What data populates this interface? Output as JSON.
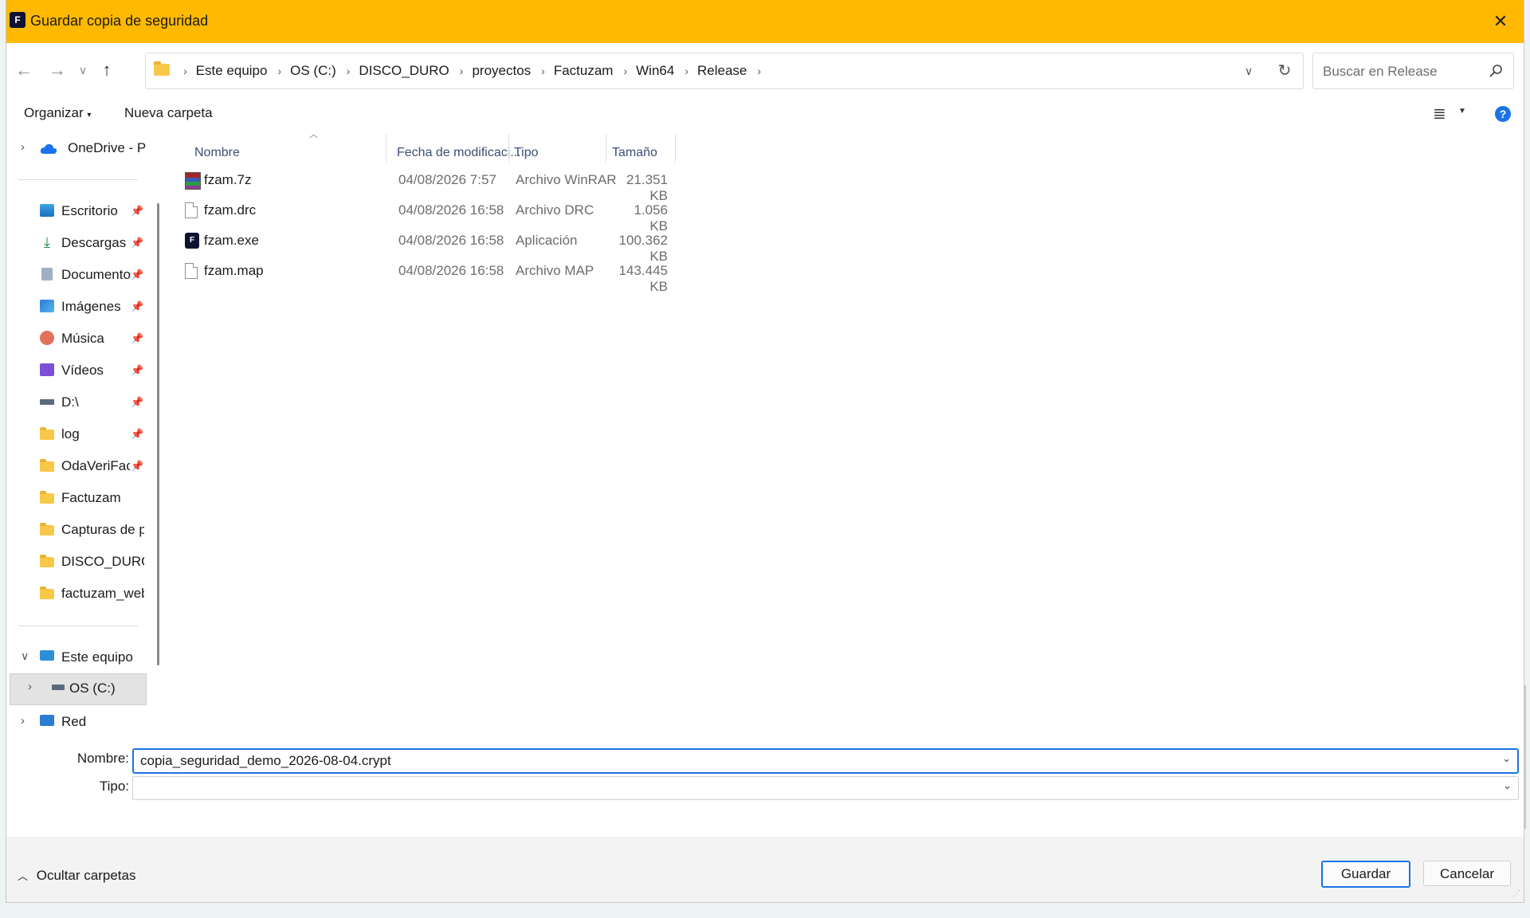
{
  "window": {
    "title": "Guardar copia de seguridad",
    "accent": "#ffb900"
  },
  "address": {
    "crumbs": [
      "Este equipo",
      "OS (C:)",
      "DISCO_DURO",
      "proyectos",
      "Factuzam",
      "Win64",
      "Release"
    ]
  },
  "search": {
    "placeholder": "Buscar en Release"
  },
  "toolbar": {
    "organize": "Organizar",
    "new_folder": "Nueva carpeta"
  },
  "nav": {
    "onedrive": "OneDrive - Pe",
    "quick": [
      {
        "label": "Escritorio",
        "icon": "desktop-icon"
      },
      {
        "label": "Descargas",
        "icon": "download-icon"
      },
      {
        "label": "Documentos",
        "icon": "documents-icon"
      },
      {
        "label": "Imágenes",
        "icon": "pictures-icon"
      },
      {
        "label": "Música",
        "icon": "music-icon"
      },
      {
        "label": "Vídeos",
        "icon": "videos-icon"
      },
      {
        "label": "D:\\",
        "icon": "drive-icon"
      },
      {
        "label": "log",
        "icon": "folder-icon"
      },
      {
        "label": "OdaVeriFac",
        "icon": "folder-icon"
      },
      {
        "label": "Factuzam",
        "icon": "folder-icon"
      },
      {
        "label": "Capturas de p",
        "icon": "folder-icon"
      },
      {
        "label": "DISCO_DURO",
        "icon": "folder-icon"
      },
      {
        "label": "factuzam_web",
        "icon": "folder-icon"
      }
    ],
    "this_pc": "Este equipo",
    "os_c": "OS (C:)",
    "network": "Red"
  },
  "columns": {
    "name": "Nombre",
    "date": "Fecha de modificaci...",
    "type": "Tipo",
    "size": "Tamaño"
  },
  "files": [
    {
      "name": "fzam.7z",
      "date": "04/08/2026 7:57",
      "type": "Archivo WinRAR",
      "size": "21.351 KB",
      "icon": "winrar-icon"
    },
    {
      "name": "fzam.drc",
      "date": "04/08/2026 16:58",
      "type": "Archivo DRC",
      "size": "1.056 KB",
      "icon": "file-icon"
    },
    {
      "name": "fzam.exe",
      "date": "04/08/2026 16:58",
      "type": "Aplicación",
      "size": "100.362 KB",
      "icon": "app-icon"
    },
    {
      "name": "fzam.map",
      "date": "04/08/2026 16:58",
      "type": "Archivo MAP",
      "size": "143.445 KB",
      "icon": "file-icon"
    }
  ],
  "form": {
    "name_label": "Nombre:",
    "name_value": "copia_seguridad_demo_2026-08-04.crypt",
    "type_label": "Tipo:",
    "type_value": ""
  },
  "footer": {
    "hide_folders": "Ocultar carpetas",
    "save": "Guardar",
    "cancel": "Cancelar"
  }
}
